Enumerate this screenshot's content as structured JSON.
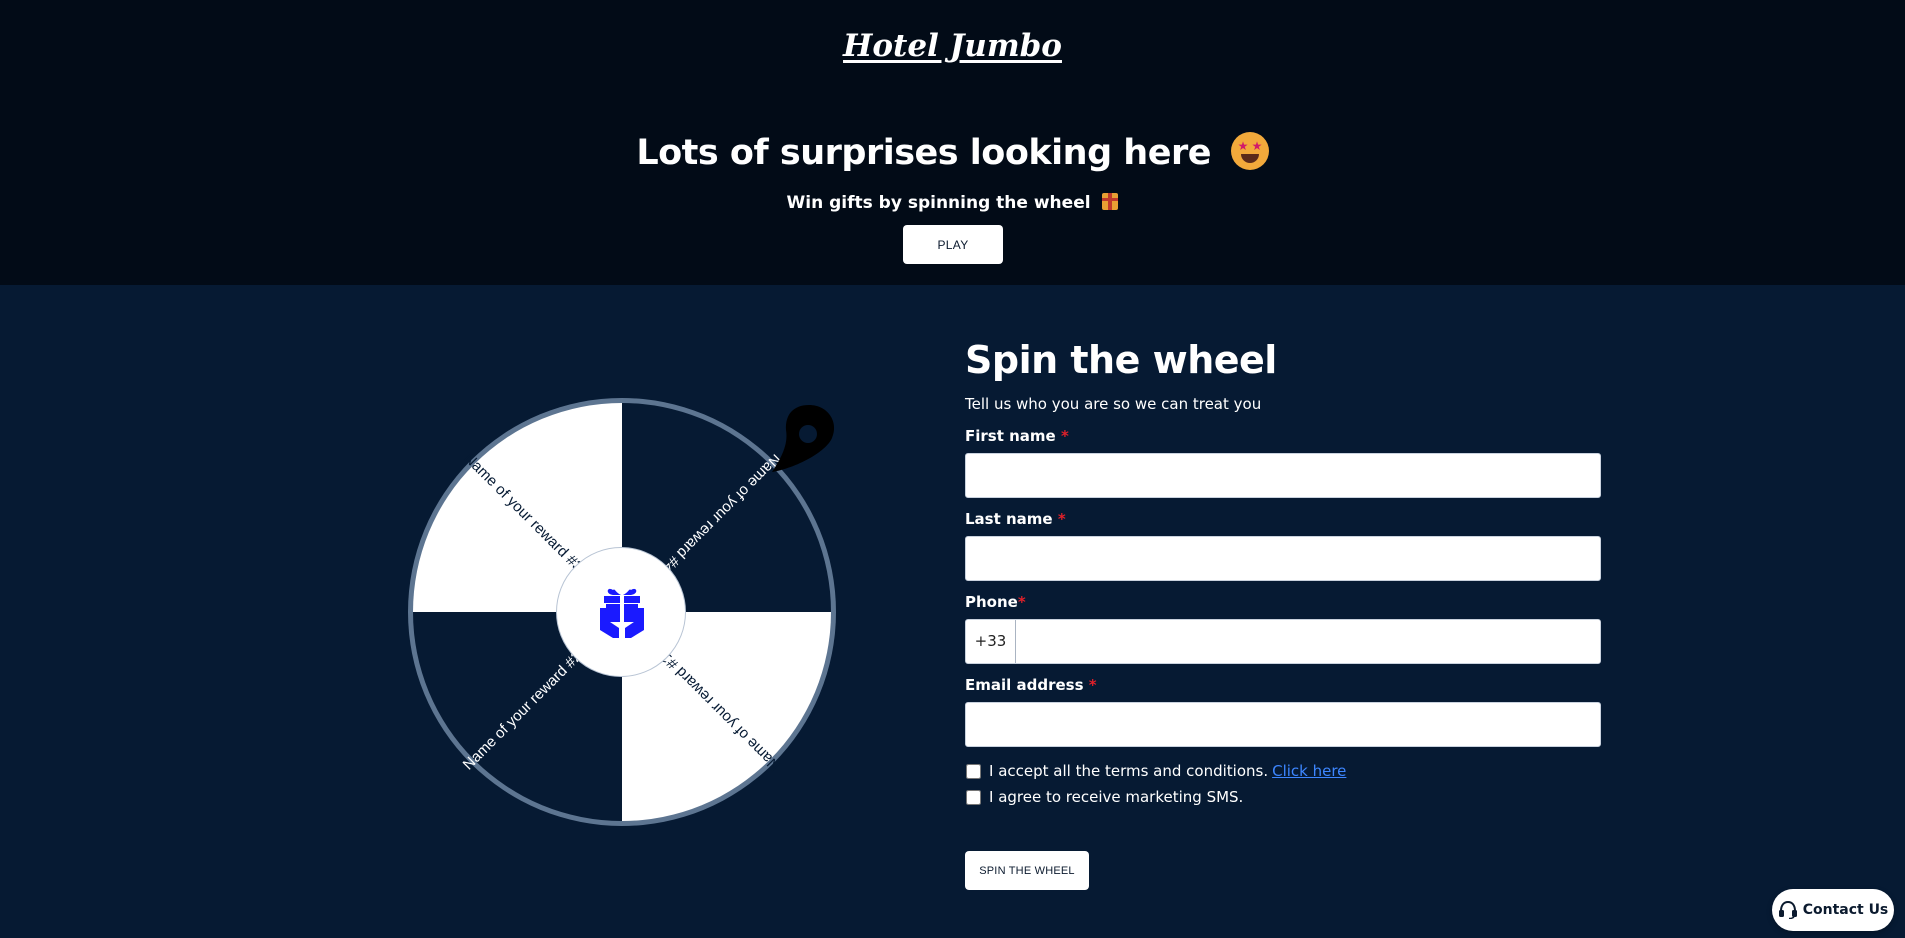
{
  "header": {
    "brand": "Hotel Jumbo",
    "title": "Lots of surprises looking here",
    "subtitle": "Win gifts by spinning the wheel",
    "play_label": "PLAY"
  },
  "wheel": {
    "segments": [
      {
        "label": "Name of your reward #1",
        "color": "#ffffff",
        "text_color": "#061a33"
      },
      {
        "label": "Name of your reward #2",
        "color": "#061a33",
        "text_color": "#ffffff"
      },
      {
        "label": "Name of your reward #3",
        "color": "#ffffff",
        "text_color": "#061a33"
      },
      {
        "label": "Name of your reward #4",
        "color": "#061a33",
        "text_color": "#ffffff"
      }
    ],
    "center_icon": "gift-hands-icon",
    "pointer_icon": "map-pin-icon",
    "rim_color": "#5d7591",
    "accent_color": "#1a1aff"
  },
  "form": {
    "title": "Spin the wheel",
    "subtitle": "Tell us who you are so we can treat you",
    "first_name_label": "First name",
    "last_name_label": "Last name",
    "phone_label": "Phone",
    "phone_prefix": "+33",
    "email_label": "Email address",
    "required_mark": "*",
    "first_name_value": "",
    "last_name_value": "",
    "phone_value": "",
    "email_value": "",
    "terms_text": "I accept all the terms and conditions.",
    "terms_link": "Click here",
    "terms_checked": false,
    "sms_text": "I agree to receive marketing SMS.",
    "sms_checked": false,
    "submit_label": "SPIN THE WHEEL"
  },
  "contact": {
    "label": "Contact Us",
    "icon": "headset-icon"
  }
}
